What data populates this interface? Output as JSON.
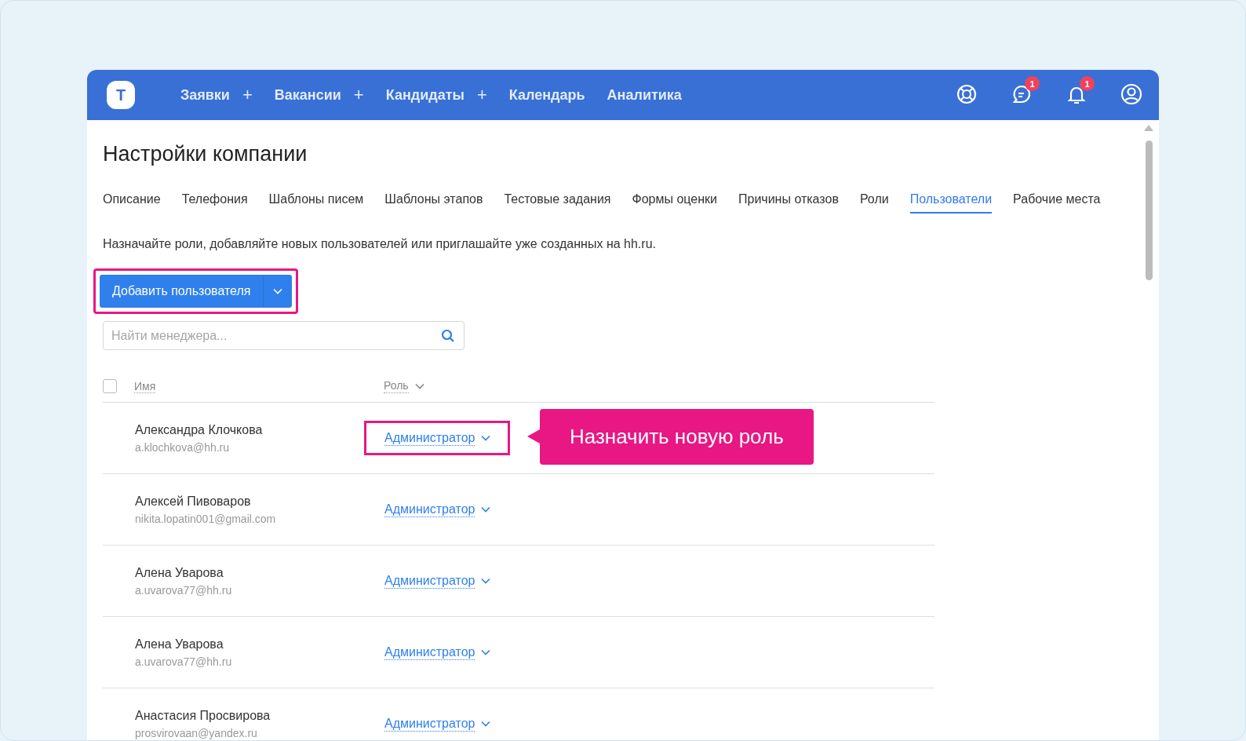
{
  "header": {
    "logo": "T",
    "nav": [
      {
        "label": "Заявки",
        "plus": "+"
      },
      {
        "label": "Вакансии",
        "plus": "+"
      },
      {
        "label": "Кандидаты",
        "plus": "+"
      },
      {
        "label": "Календарь"
      },
      {
        "label": "Аналитика"
      }
    ],
    "badges": {
      "messages": "1",
      "notifications": "1"
    }
  },
  "title": "Настройки компании",
  "tabs": [
    {
      "label": "Описание",
      "selected": false
    },
    {
      "label": "Телефония",
      "selected": false
    },
    {
      "label": "Шаблоны писем",
      "selected": false
    },
    {
      "label": "Шаблоны этапов",
      "selected": false
    },
    {
      "label": "Тестовые задания",
      "selected": false
    },
    {
      "label": "Формы оценки",
      "selected": false
    },
    {
      "label": "Причины отказов",
      "selected": false
    },
    {
      "label": "Роли",
      "selected": false
    },
    {
      "label": "Пользователи",
      "selected": true
    },
    {
      "label": "Рабочие места",
      "selected": false
    }
  ],
  "description": "Назначайте роли, добавляйте новых пользователей или приглашайте уже созданных на hh.ru.",
  "add_button": {
    "label": "Добавить пользователя",
    "highlighted": true
  },
  "search": {
    "placeholder": "Найти менеджера..."
  },
  "table": {
    "select_all_checked": false,
    "columns": [
      "Имя",
      "Роль"
    ],
    "rows": [
      {
        "name": "Александра Клочкова",
        "email": "a.klochkova@hh.ru",
        "role": "Администратор",
        "role_highlighted": true,
        "callout": "Назначить новую роль"
      },
      {
        "name": "Алексей Пивоваров",
        "email": "nikita.lopatin001@gmail.com",
        "role": "Администратор",
        "role_highlighted": false
      },
      {
        "name": "Алена Уварова",
        "email": "a.uvarova77@hh.ru",
        "role": "Администратор",
        "role_highlighted": false
      },
      {
        "name": "Алена Уварова",
        "email": "a.uvarova77@hh.ru",
        "role": "Администратор",
        "role_highlighted": false
      },
      {
        "name": "Анастасия Просвирова",
        "email": "prosvirovaan@yandex.ru",
        "role": "Администратор",
        "role_highlighted": false
      }
    ]
  }
}
